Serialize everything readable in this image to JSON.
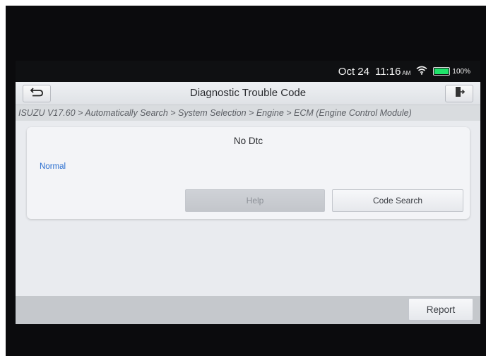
{
  "status_bar": {
    "date": "Oct 24",
    "time": "11:16",
    "ampm": "AM",
    "battery": "100%"
  },
  "header": {
    "title": "Diagnostic Trouble Code",
    "back_icon": "back-arrow-icon",
    "exit_icon": "exit-door-icon"
  },
  "breadcrumb": "ISUZU V17.60 > Automatically Search > System Selection > Engine > ECM (Engine Control Module)",
  "result": {
    "message": "No Dtc",
    "status": "Normal",
    "status_color": "#2b6fd0"
  },
  "actions": {
    "help_label": "Help",
    "code_search_label": "Code Search"
  },
  "footer": {
    "report_label": "Report"
  }
}
